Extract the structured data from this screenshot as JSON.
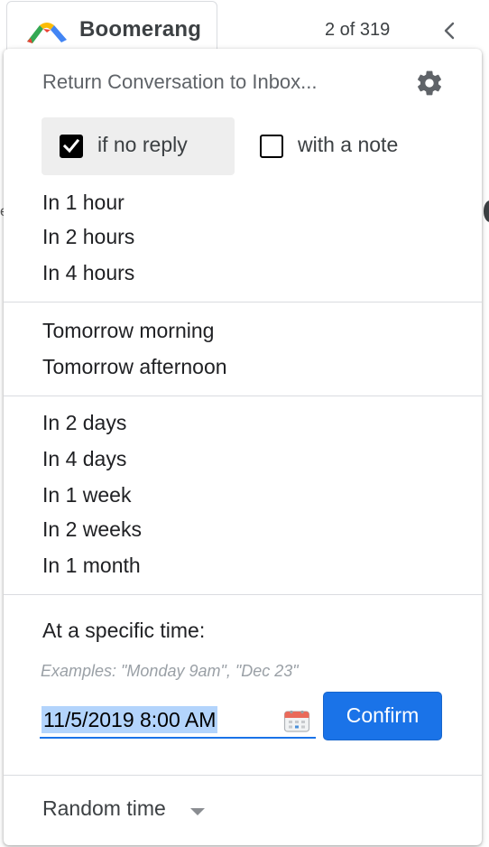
{
  "toolbar": {
    "app_name": "Boomerang",
    "pager": "2 of 319",
    "left_fragment": "e"
  },
  "menu": {
    "title": "Return Conversation to Inbox...",
    "options": {
      "no_reply": {
        "label": "if no reply",
        "checked": true
      },
      "with_note": {
        "label": "with a note",
        "checked": false
      }
    },
    "groups": {
      "short": [
        "In 1 hour",
        "In 2 hours",
        "In 4 hours"
      ],
      "tomorrow": [
        "Tomorrow morning",
        "Tomorrow afternoon"
      ],
      "later": [
        "In 2 days",
        "In 4 days",
        "In 1 week",
        "In 2 weeks",
        "In 1 month"
      ]
    },
    "specific": {
      "label": "At a specific time:",
      "examples": "Examples: \"Monday 9am\", \"Dec 23\"",
      "value": "11/5/2019 8:00 AM",
      "confirm_label": "Confirm"
    },
    "random_label": "Random time"
  },
  "colors": {
    "accent": "#1a73e8",
    "selection": "#b3d4fc",
    "option_bg": "#eeeeee",
    "divider": "#dadce0"
  },
  "icons": [
    "boomerang-logo-icon",
    "chevron-left-icon",
    "gear-icon",
    "checkbox-checked-icon",
    "checkbox-empty-icon",
    "calendar-icon",
    "caret-down-icon"
  ]
}
